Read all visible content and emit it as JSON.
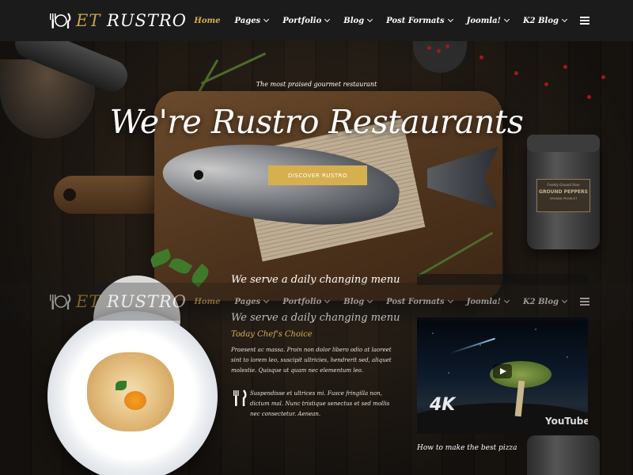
{
  "brand": {
    "et": "ET",
    "name": "RUSTRO"
  },
  "nav": {
    "items": [
      {
        "label": "Home",
        "active": true,
        "has_dropdown": false
      },
      {
        "label": "Pages",
        "active": false,
        "has_dropdown": true
      },
      {
        "label": "Portfolio",
        "active": false,
        "has_dropdown": true
      },
      {
        "label": "Blog",
        "active": false,
        "has_dropdown": true
      },
      {
        "label": "Post Formats",
        "active": false,
        "has_dropdown": true
      },
      {
        "label": "Joomla!",
        "active": false,
        "has_dropdown": true
      },
      {
        "label": "K2 Blog",
        "active": false,
        "has_dropdown": true
      }
    ],
    "menu_icon": "hamburger-icon"
  },
  "hero": {
    "eyebrow": "The most praised gourmet restaurant",
    "headline": "We're Rustro Restaurants",
    "cta": "DISCOVER RUSTRO",
    "jar_label": {
      "line1": "Freshly Ground from",
      "line2": "GROUND PEPPERS",
      "line3": "ORGANIC PRODUCT"
    }
  },
  "section": {
    "heading": "We serve a daily changing menu",
    "heading_ghost": "We serve a daily changing menu",
    "subheading": "Today Chef's Choice",
    "paragraph1": "Praesent ac massa. Proin non dolor libero odio at laoreet sint to lorem leo, suscipit ultricies, hendrerit sed, aliquet molestie. Quisque ut quam nec elementum leo.",
    "paragraph2": "Suspendisse et ultrices mi. Fusce fringilla non, dictum mal. Nunc tristique senectus et sed mollis nec consectetur. Aenean.",
    "fork_icon": "fork-knife-icon",
    "video_title": "How to make the best pizza",
    "video_badge": "4K",
    "video_platform": "YouTube"
  },
  "colors": {
    "accent": "#d6b04f",
    "nav_bg": "#1b1b1b",
    "text": "#ffffff"
  }
}
